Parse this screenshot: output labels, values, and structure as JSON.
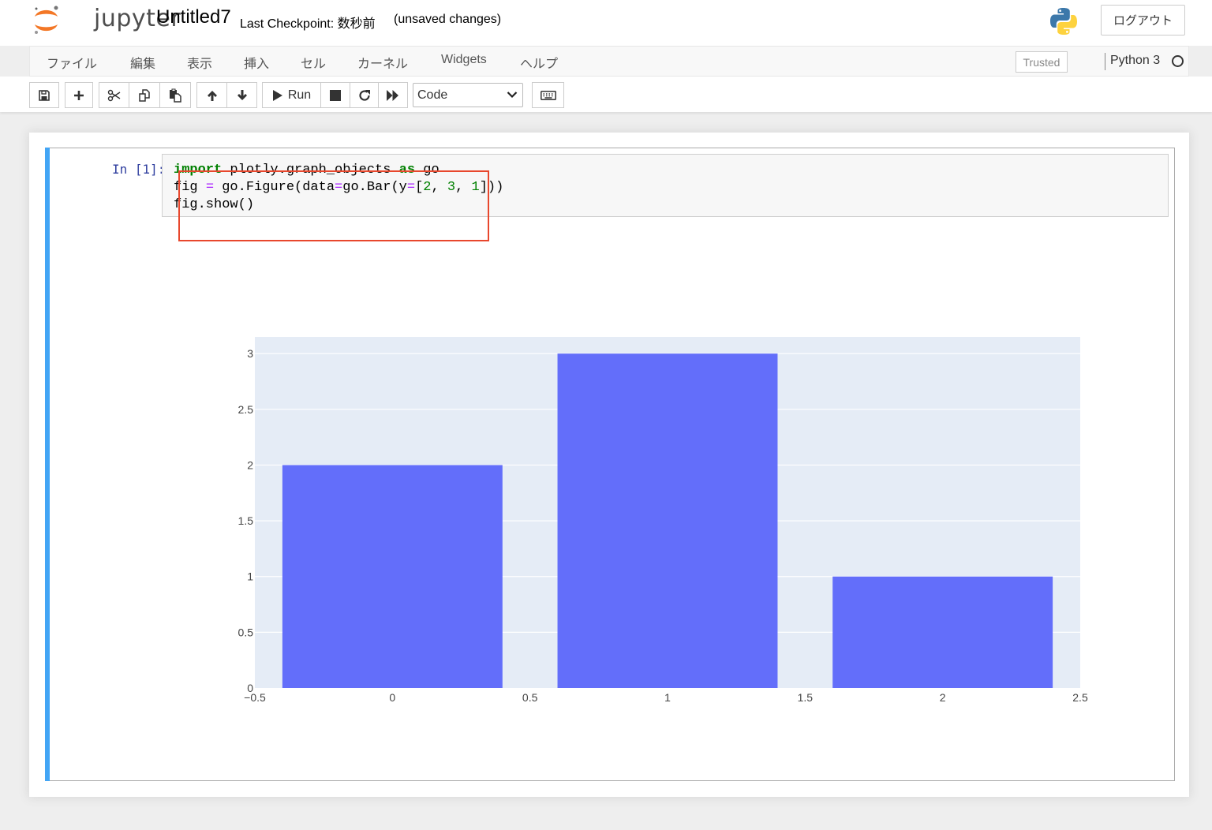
{
  "header": {
    "logo_text": "jupyter",
    "notebook_title": "Untitled7",
    "checkpoint_text": "Last Checkpoint: 数秒前",
    "autosave_status": "(unsaved changes)",
    "logout_label": "ログアウト"
  },
  "menubar": {
    "items": [
      "ファイル",
      "編集",
      "表示",
      "挿入",
      "セル",
      "カーネル",
      "Widgets",
      "ヘルプ"
    ],
    "trusted_label": "Trusted",
    "kernel_name": "Python 3"
  },
  "toolbar": {
    "run_label": "Run",
    "cell_type": "Code",
    "icons": [
      "save-icon",
      "plus-icon",
      "scissors-icon",
      "copy-icon",
      "paste-icon",
      "arrow-up-icon",
      "arrow-down-icon",
      "play-icon",
      "stop-icon",
      "restart-icon",
      "fast-forward-icon",
      "keyboard-icon"
    ]
  },
  "cell": {
    "prompt": "In [1]:",
    "code_lines": [
      "import plotly.graph_objects as go",
      "fig = go.Figure(data=go.Bar(y=[2, 3, 1]))",
      "fig.show()"
    ]
  },
  "colors": {
    "bar": "#636efa",
    "plot_bg": "#e5ecf6",
    "cell_bar": "#42a5f5",
    "highlight": "#e8472d"
  },
  "chart_data": {
    "type": "bar",
    "x": [
      0,
      1,
      2
    ],
    "values": [
      2,
      3,
      1
    ],
    "xlim": [
      -0.5,
      2.5
    ],
    "ylim": [
      0,
      3.15
    ],
    "xticks": [
      -0.5,
      0,
      0.5,
      1,
      1.5,
      2,
      2.5
    ],
    "xtick_labels": [
      "−0.5",
      "0",
      "0.5",
      "1",
      "1.5",
      "2",
      "2.5"
    ],
    "yticks": [
      0,
      0.5,
      1,
      1.5,
      2,
      2.5,
      3
    ],
    "ytick_labels": [
      "0",
      "0.5",
      "1",
      "1.5",
      "2",
      "2.5",
      "3"
    ],
    "bar_width": 0.8,
    "grid": true
  }
}
